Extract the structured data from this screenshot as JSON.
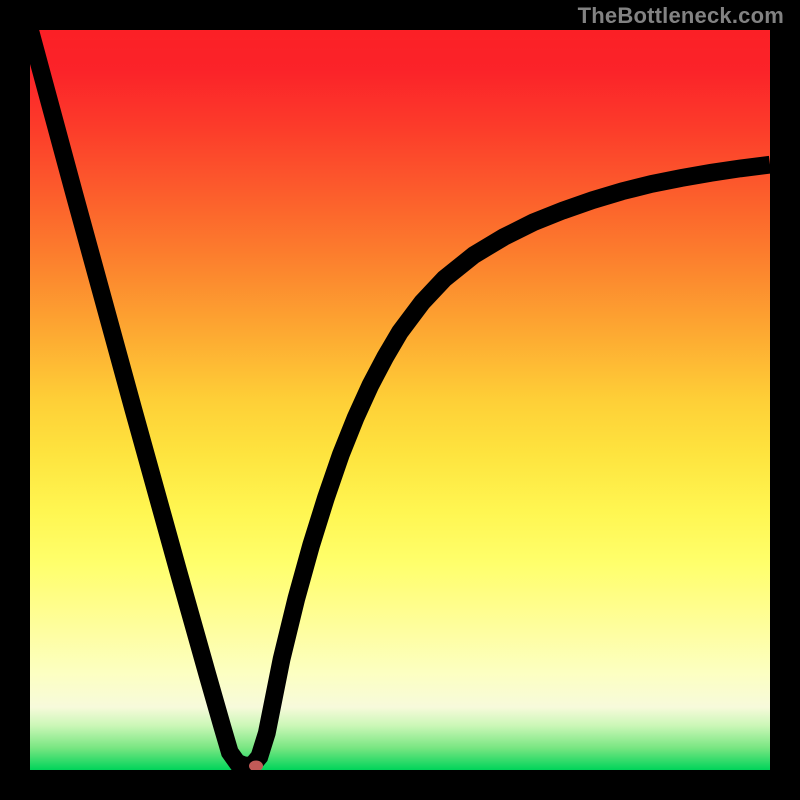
{
  "watermark": {
    "text": "TheBottleneck.com"
  },
  "chart_data": {
    "type": "line",
    "title": "",
    "xlabel": "",
    "ylabel": "",
    "xlim": [
      0,
      100
    ],
    "ylim": [
      0,
      100
    ],
    "grid": false,
    "legend": false,
    "series": [
      {
        "name": "bottleneck-curve",
        "x": [
          0,
          2,
          4,
          6,
          8,
          10,
          12,
          14,
          16,
          18,
          20,
          22,
          24,
          26,
          27,
          28,
          29,
          30,
          31,
          32,
          33,
          34,
          36,
          38,
          40,
          42,
          44,
          46,
          48,
          50,
          53,
          56,
          60,
          64,
          68,
          72,
          76,
          80,
          84,
          88,
          92,
          96,
          100
        ],
        "values": [
          100,
          92.6,
          85.2,
          77.8,
          70.5,
          63.2,
          55.9,
          48.6,
          41.4,
          34.2,
          27.0,
          19.9,
          12.8,
          5.8,
          2.4,
          1.0,
          0.6,
          0.6,
          1.8,
          5.0,
          10.0,
          15.0,
          23.2,
          30.4,
          36.8,
          42.6,
          47.6,
          52.0,
          55.8,
          59.2,
          63.2,
          66.4,
          69.6,
          72.0,
          74.0,
          75.6,
          77.0,
          78.2,
          79.2,
          80.0,
          80.7,
          81.3,
          81.8
        ]
      }
    ],
    "marker": {
      "x": 30.5,
      "y": 0.5
    },
    "background_gradient": {
      "type": "vertical",
      "stops": [
        {
          "pos": 0.0,
          "color": "#fb2026"
        },
        {
          "pos": 0.5,
          "color": "#fecf37"
        },
        {
          "pos": 0.78,
          "color": "#fffe8d"
        },
        {
          "pos": 1.0,
          "color": "#00d45a"
        }
      ]
    }
  }
}
